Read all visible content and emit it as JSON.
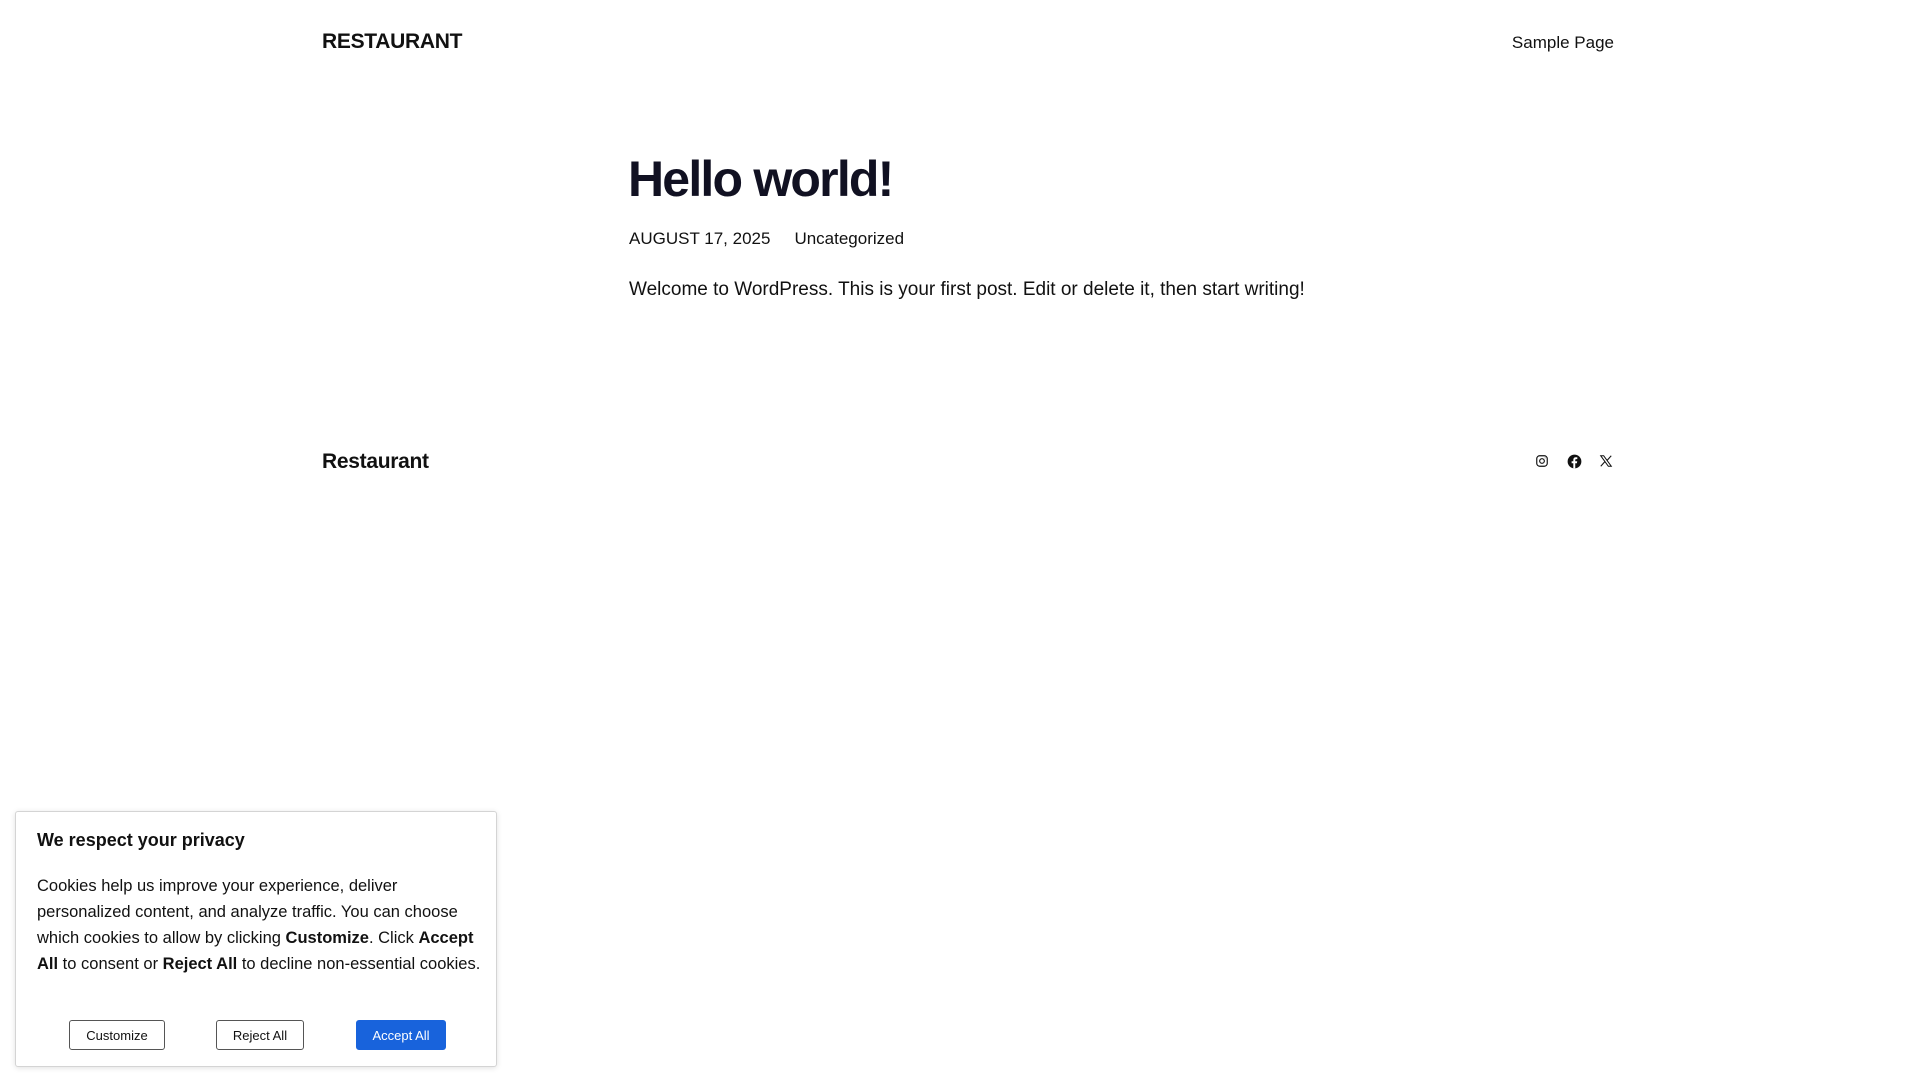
{
  "header": {
    "site_title": "RESTAURANT",
    "nav": [
      {
        "label": "Sample Page"
      }
    ]
  },
  "post": {
    "title": "Hello world!",
    "date": "AUGUST 17, 2025",
    "category": "Uncategorized",
    "body": "Welcome to WordPress. This is your first post. Edit or delete it, then start writing!"
  },
  "footer": {
    "site_title": "Restaurant",
    "social": [
      {
        "icon": "instagram-icon"
      },
      {
        "icon": "facebook-icon"
      },
      {
        "icon": "x-icon"
      }
    ]
  },
  "cookie_banner": {
    "title": "We respect your privacy",
    "text_1": "Cookies help us improve your experience, deliver personalized content, and analyze traffic. You can choose which cookies to allow by clicking ",
    "text_customize": "Customize",
    "text_2": ". Click ",
    "text_accept": "Accept All",
    "text_3": " to consent or ",
    "text_reject": "Reject All",
    "text_4": " to decline non-essential cookies.",
    "customize_label": "Customize",
    "reject_label": "Reject All",
    "accept_label": "Accept All",
    "accent_color": "#1863dc"
  }
}
